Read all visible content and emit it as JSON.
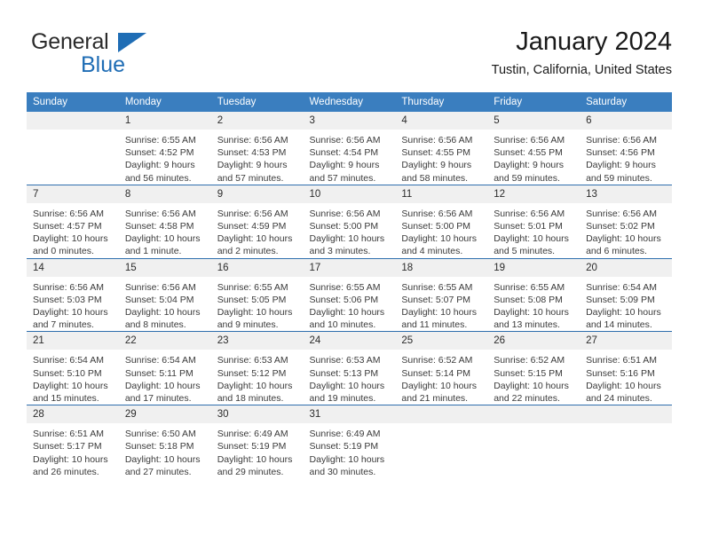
{
  "brand": {
    "line1": "General",
    "line2": "Blue",
    "triangle_color": "#1f6db5"
  },
  "header": {
    "title": "January 2024",
    "subtitle": "Tustin, California, United States"
  },
  "theme": {
    "header_blue": "#3a7ebf",
    "separator_blue": "#2f6fae",
    "daynum_band": "#f0f0f0",
    "text": "#3a3a3a"
  },
  "calendar": {
    "weekday_headers": [
      "Sunday",
      "Monday",
      "Tuesday",
      "Wednesday",
      "Thursday",
      "Friday",
      "Saturday"
    ],
    "labels": {
      "sunrise": "Sunrise:",
      "sunset": "Sunset:",
      "daylight": "Daylight:"
    },
    "weeks": [
      [
        {
          "day": "",
          "blank": true
        },
        {
          "day": "1",
          "sunrise": "Sunrise: 6:55 AM",
          "sunset": "Sunset: 4:52 PM",
          "daylight1": "Daylight: 9 hours",
          "daylight2": "and 56 minutes."
        },
        {
          "day": "2",
          "sunrise": "Sunrise: 6:56 AM",
          "sunset": "Sunset: 4:53 PM",
          "daylight1": "Daylight: 9 hours",
          "daylight2": "and 57 minutes."
        },
        {
          "day": "3",
          "sunrise": "Sunrise: 6:56 AM",
          "sunset": "Sunset: 4:54 PM",
          "daylight1": "Daylight: 9 hours",
          "daylight2": "and 57 minutes."
        },
        {
          "day": "4",
          "sunrise": "Sunrise: 6:56 AM",
          "sunset": "Sunset: 4:55 PM",
          "daylight1": "Daylight: 9 hours",
          "daylight2": "and 58 minutes."
        },
        {
          "day": "5",
          "sunrise": "Sunrise: 6:56 AM",
          "sunset": "Sunset: 4:55 PM",
          "daylight1": "Daylight: 9 hours",
          "daylight2": "and 59 minutes."
        },
        {
          "day": "6",
          "sunrise": "Sunrise: 6:56 AM",
          "sunset": "Sunset: 4:56 PM",
          "daylight1": "Daylight: 9 hours",
          "daylight2": "and 59 minutes."
        }
      ],
      [
        {
          "day": "7",
          "sunrise": "Sunrise: 6:56 AM",
          "sunset": "Sunset: 4:57 PM",
          "daylight1": "Daylight: 10 hours",
          "daylight2": "and 0 minutes."
        },
        {
          "day": "8",
          "sunrise": "Sunrise: 6:56 AM",
          "sunset": "Sunset: 4:58 PM",
          "daylight1": "Daylight: 10 hours",
          "daylight2": "and 1 minute."
        },
        {
          "day": "9",
          "sunrise": "Sunrise: 6:56 AM",
          "sunset": "Sunset: 4:59 PM",
          "daylight1": "Daylight: 10 hours",
          "daylight2": "and 2 minutes."
        },
        {
          "day": "10",
          "sunrise": "Sunrise: 6:56 AM",
          "sunset": "Sunset: 5:00 PM",
          "daylight1": "Daylight: 10 hours",
          "daylight2": "and 3 minutes."
        },
        {
          "day": "11",
          "sunrise": "Sunrise: 6:56 AM",
          "sunset": "Sunset: 5:00 PM",
          "daylight1": "Daylight: 10 hours",
          "daylight2": "and 4 minutes."
        },
        {
          "day": "12",
          "sunrise": "Sunrise: 6:56 AM",
          "sunset": "Sunset: 5:01 PM",
          "daylight1": "Daylight: 10 hours",
          "daylight2": "and 5 minutes."
        },
        {
          "day": "13",
          "sunrise": "Sunrise: 6:56 AM",
          "sunset": "Sunset: 5:02 PM",
          "daylight1": "Daylight: 10 hours",
          "daylight2": "and 6 minutes."
        }
      ],
      [
        {
          "day": "14",
          "sunrise": "Sunrise: 6:56 AM",
          "sunset": "Sunset: 5:03 PM",
          "daylight1": "Daylight: 10 hours",
          "daylight2": "and 7 minutes."
        },
        {
          "day": "15",
          "sunrise": "Sunrise: 6:56 AM",
          "sunset": "Sunset: 5:04 PM",
          "daylight1": "Daylight: 10 hours",
          "daylight2": "and 8 minutes."
        },
        {
          "day": "16",
          "sunrise": "Sunrise: 6:55 AM",
          "sunset": "Sunset: 5:05 PM",
          "daylight1": "Daylight: 10 hours",
          "daylight2": "and 9 minutes."
        },
        {
          "day": "17",
          "sunrise": "Sunrise: 6:55 AM",
          "sunset": "Sunset: 5:06 PM",
          "daylight1": "Daylight: 10 hours",
          "daylight2": "and 10 minutes."
        },
        {
          "day": "18",
          "sunrise": "Sunrise: 6:55 AM",
          "sunset": "Sunset: 5:07 PM",
          "daylight1": "Daylight: 10 hours",
          "daylight2": "and 11 minutes."
        },
        {
          "day": "19",
          "sunrise": "Sunrise: 6:55 AM",
          "sunset": "Sunset: 5:08 PM",
          "daylight1": "Daylight: 10 hours",
          "daylight2": "and 13 minutes."
        },
        {
          "day": "20",
          "sunrise": "Sunrise: 6:54 AM",
          "sunset": "Sunset: 5:09 PM",
          "daylight1": "Daylight: 10 hours",
          "daylight2": "and 14 minutes."
        }
      ],
      [
        {
          "day": "21",
          "sunrise": "Sunrise: 6:54 AM",
          "sunset": "Sunset: 5:10 PM",
          "daylight1": "Daylight: 10 hours",
          "daylight2": "and 15 minutes."
        },
        {
          "day": "22",
          "sunrise": "Sunrise: 6:54 AM",
          "sunset": "Sunset: 5:11 PM",
          "daylight1": "Daylight: 10 hours",
          "daylight2": "and 17 minutes."
        },
        {
          "day": "23",
          "sunrise": "Sunrise: 6:53 AM",
          "sunset": "Sunset: 5:12 PM",
          "daylight1": "Daylight: 10 hours",
          "daylight2": "and 18 minutes."
        },
        {
          "day": "24",
          "sunrise": "Sunrise: 6:53 AM",
          "sunset": "Sunset: 5:13 PM",
          "daylight1": "Daylight: 10 hours",
          "daylight2": "and 19 minutes."
        },
        {
          "day": "25",
          "sunrise": "Sunrise: 6:52 AM",
          "sunset": "Sunset: 5:14 PM",
          "daylight1": "Daylight: 10 hours",
          "daylight2": "and 21 minutes."
        },
        {
          "day": "26",
          "sunrise": "Sunrise: 6:52 AM",
          "sunset": "Sunset: 5:15 PM",
          "daylight1": "Daylight: 10 hours",
          "daylight2": "and 22 minutes."
        },
        {
          "day": "27",
          "sunrise": "Sunrise: 6:51 AM",
          "sunset": "Sunset: 5:16 PM",
          "daylight1": "Daylight: 10 hours",
          "daylight2": "and 24 minutes."
        }
      ],
      [
        {
          "day": "28",
          "sunrise": "Sunrise: 6:51 AM",
          "sunset": "Sunset: 5:17 PM",
          "daylight1": "Daylight: 10 hours",
          "daylight2": "and 26 minutes."
        },
        {
          "day": "29",
          "sunrise": "Sunrise: 6:50 AM",
          "sunset": "Sunset: 5:18 PM",
          "daylight1": "Daylight: 10 hours",
          "daylight2": "and 27 minutes."
        },
        {
          "day": "30",
          "sunrise": "Sunrise: 6:49 AM",
          "sunset": "Sunset: 5:19 PM",
          "daylight1": "Daylight: 10 hours",
          "daylight2": "and 29 minutes."
        },
        {
          "day": "31",
          "sunrise": "Sunrise: 6:49 AM",
          "sunset": "Sunset: 5:19 PM",
          "daylight1": "Daylight: 10 hours",
          "daylight2": "and 30 minutes."
        },
        {
          "day": "",
          "blank": true
        },
        {
          "day": "",
          "blank": true
        },
        {
          "day": "",
          "blank": true
        }
      ]
    ]
  }
}
